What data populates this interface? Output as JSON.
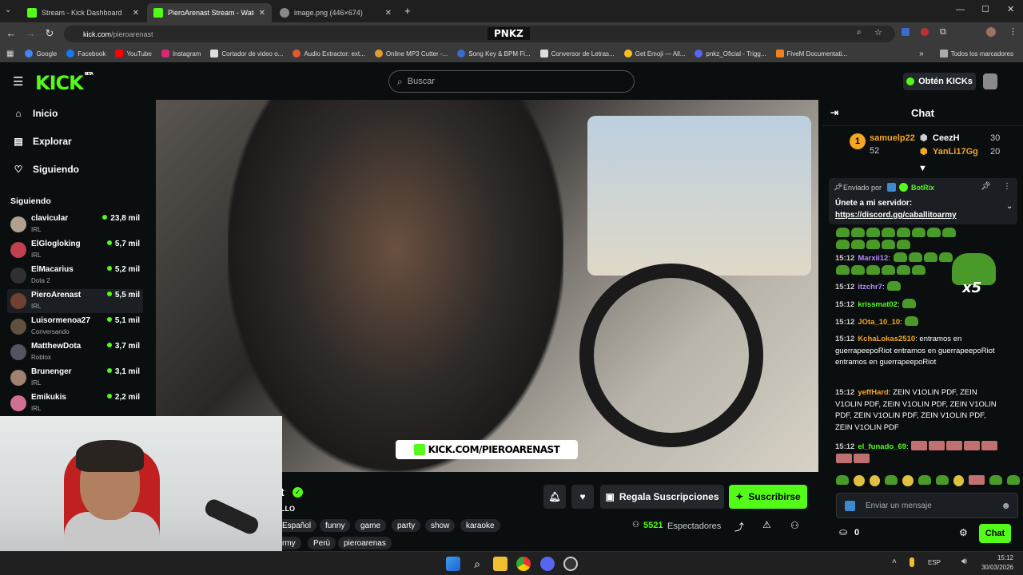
{
  "browser": {
    "tabs": [
      {
        "title": "Stream - Kick Dashboard",
        "active": false
      },
      {
        "title": "PieroArenast Stream - Wate",
        "active": true
      },
      {
        "title": "image.png (446×674)",
        "active": false
      }
    ],
    "url_host": "kick.com",
    "url_path": "/pieroarenast",
    "extension_badge": "PNKZ",
    "bookmarks": [
      "Google",
      "Facebook",
      "YouTube",
      "Instagram",
      "Cortador de video o...",
      "Audio Extractor: ext...",
      "Online MP3 Cutter -...",
      "Song Key & BPM Fi...",
      "Conversor de Letras...",
      "Get Emoji — All...",
      "pnkz_Oficial - Trigg...",
      "FiveM Documentati..."
    ],
    "all_bookmarks": "Todos los marcadores"
  },
  "header": {
    "logo": "KICK",
    "logo_badge": "BETA",
    "search_placeholder": "Buscar",
    "get_kicks": "Obtén KICKs"
  },
  "sidebar": {
    "nav": [
      {
        "label": "Inicio",
        "icon": "home-icon"
      },
      {
        "label": "Explorar",
        "icon": "compass-icon"
      },
      {
        "label": "Siguiendo",
        "icon": "heart-icon"
      }
    ],
    "following_title": "Siguiendo",
    "following": [
      {
        "name": "clavicular",
        "category": "IRL",
        "viewers": "23,8 mil",
        "color": "#b0a090"
      },
      {
        "name": "ElGlogloking",
        "category": "IRL",
        "viewers": "5,7 mil",
        "color": "#c04050"
      },
      {
        "name": "ElMacarius",
        "category": "Dota 2",
        "viewers": "5,2 mil",
        "color": "#303030"
      },
      {
        "name": "PieroArenast",
        "category": "IRL",
        "viewers": "5,5 mil",
        "color": "#704030"
      },
      {
        "name": "Luisormenoa27",
        "category": "Conversando",
        "viewers": "5,1 mil",
        "color": "#605040"
      },
      {
        "name": "MatthewDota",
        "category": "Roblox",
        "viewers": "3,7 mil",
        "color": "#505560"
      },
      {
        "name": "Brunenger",
        "category": "IRL",
        "viewers": "3,1 mil",
        "color": "#a08070"
      },
      {
        "name": "Emikukis",
        "category": "IRL",
        "viewers": "2,2 mil",
        "color": "#d07090"
      }
    ]
  },
  "stream": {
    "watermark": "KICK.COM/PIEROARENAST",
    "title_fragment": "t",
    "subtitle_fragment": "LLO",
    "tags_row1": [
      "Español",
      "funny",
      "game",
      "party",
      "show",
      "karaoke"
    ],
    "tags_row2": [
      "rmy",
      "Perù",
      "pieroarenas"
    ],
    "gift_subs": "Regala Suscripciones",
    "subscribe": "Suscribirse",
    "viewers_count": "5521",
    "viewers_label": "Espectadores"
  },
  "chat": {
    "title": "Chat",
    "leaderboard": [
      {
        "rank": "1",
        "name": "samuelp22",
        "count": "52",
        "color": "#f5a623"
      },
      {
        "name": "CeezH",
        "count": "30",
        "color": "#ffffff"
      },
      {
        "name": "YanLi17Gg",
        "count": "20",
        "color": "#f5a623"
      }
    ],
    "pinned_by_label": "Enviado por",
    "pinned_by": "BotRix",
    "pinned_text": "Únete a mi servidor:",
    "pinned_link": "https://discord.gg/caballitoarmy",
    "messages": [
      {
        "time": "15:12",
        "user": "Marxii12",
        "color": "#b58aff",
        "text": ""
      },
      {
        "time": "15:12",
        "user": "itzchr7",
        "color": "#b58aff",
        "text": ""
      },
      {
        "time": "15:12",
        "user": "krissmat02",
        "color": "#53fc18",
        "text": ""
      },
      {
        "time": "15:12",
        "user": "JOta_10_10",
        "color": "#f5a623",
        "text": ""
      },
      {
        "time": "15:12",
        "user": "KchaLokas2510",
        "color": "#f5a623",
        "text": "entramos en guerrapeepoRiot entramos en guerrapeepoRiot entramos en guerrapeepoRiot"
      },
      {
        "time": "15:12",
        "user": "yeffHard",
        "color": "#f5a623",
        "text": "ZEIN V1OLIN PDF, ZEIN V1OLIN PDF, ZEIN V1OLIN PDF, ZEIN V1OLIN PDF, ZEIN V1OLIN PDF, ZEIN V1OLIN PDF, ZEIN V1OLIN PDF"
      },
      {
        "time": "15:12",
        "user": "el_funado_69",
        "color": "#53fc18",
        "text": ""
      }
    ],
    "multiplier": "x5",
    "input_placeholder": "Enviar un mensaje",
    "points": "0",
    "send": "Chat"
  },
  "taskbar": {
    "lang": "ESP",
    "time": "15:12",
    "date": "30/03/2026"
  }
}
